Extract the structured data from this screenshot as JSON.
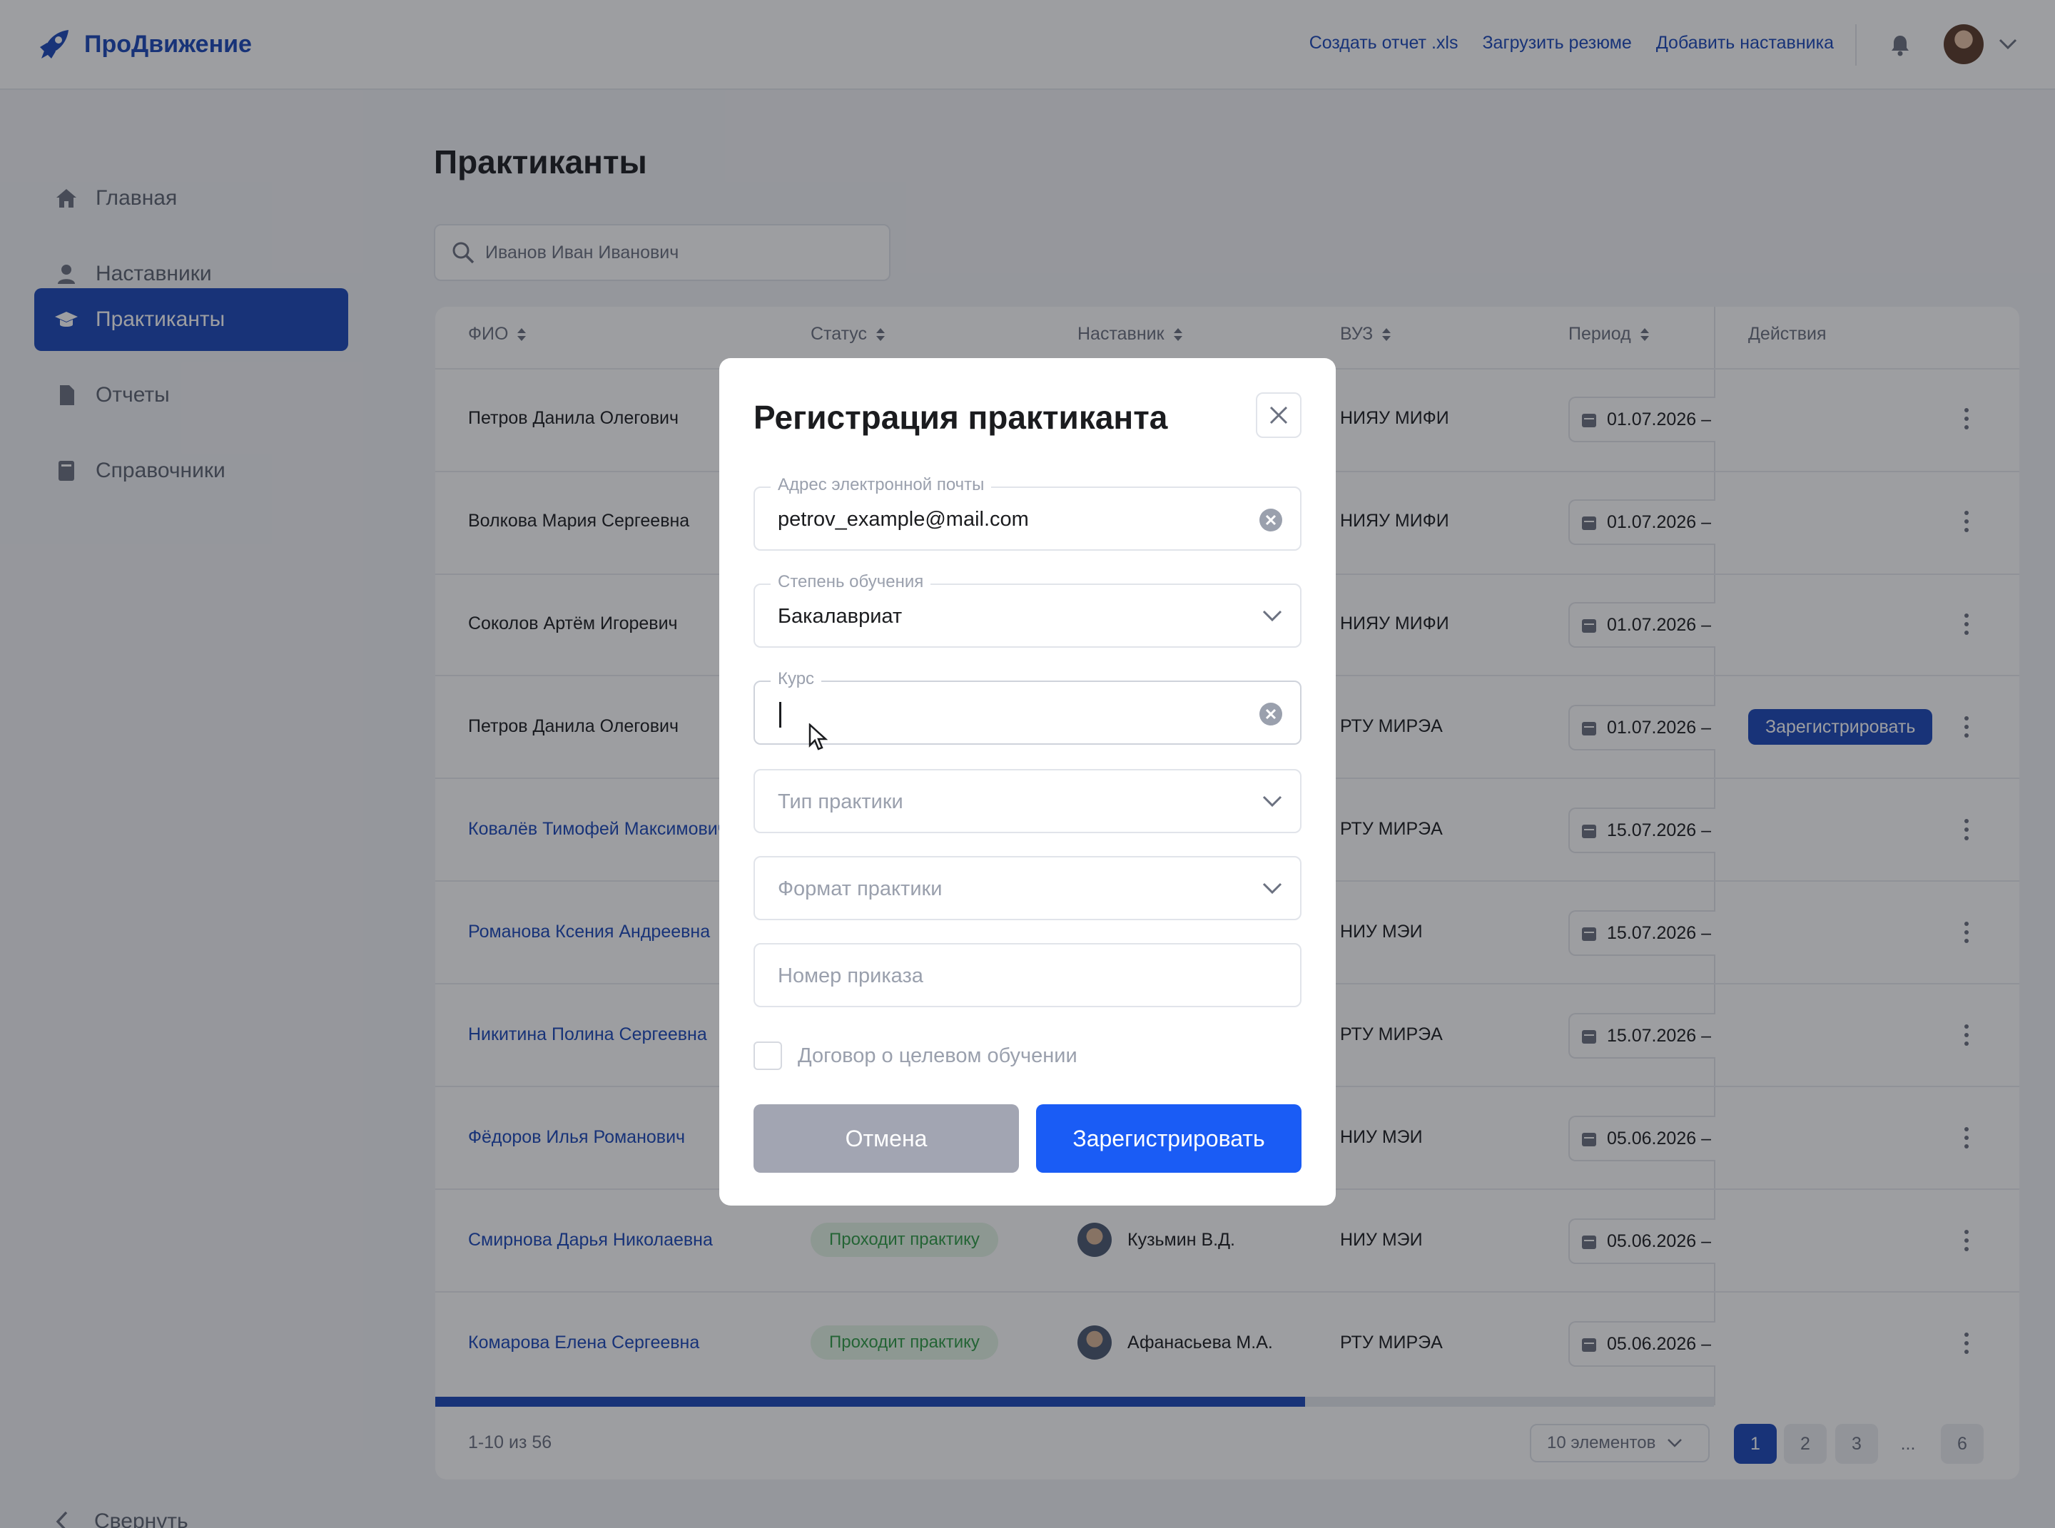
{
  "app": {
    "name": "ПроДвижение"
  },
  "header": {
    "links": [
      "Создать отчет .xls",
      "Загрузить резюме",
      "Добавить наставника"
    ]
  },
  "sidebar": {
    "items": [
      {
        "label": "Главная",
        "icon": "home-icon"
      },
      {
        "label": "Наставники",
        "icon": "user-icon"
      },
      {
        "label": "Практиканты",
        "icon": "graduation-cap-icon",
        "active": true
      },
      {
        "label": "Отчеты",
        "icon": "document-icon"
      },
      {
        "label": "Справочники",
        "icon": "book-icon"
      }
    ],
    "collapse_label": "Свернуть"
  },
  "page": {
    "title": "Практиканты",
    "search_value": "Иванов Иван Иванович"
  },
  "table": {
    "columns": [
      "ФИО",
      "Статус",
      "Наставник",
      "ВУЗ",
      "Период",
      "Действия"
    ],
    "rows": [
      {
        "name": "Петров Данила Олегович",
        "university": "НИЯУ МИФИ",
        "period": "01.07.2026 –"
      },
      {
        "name": "Волкова Мария Сергеевна",
        "university": "НИЯУ МИФИ",
        "period": "01.07.2026 –"
      },
      {
        "name": "Соколов Артём Игоревич",
        "university": "НИЯУ МИФИ",
        "period": "01.07.2026 –"
      },
      {
        "name": "Петров Данила Олегович",
        "university": "РТУ МИРЭА",
        "period": "01.07.2026 –",
        "action": "Зарегистрировать"
      },
      {
        "name": "Ковалёв Тимофей Максимович",
        "university": "РТУ МИРЭА",
        "period": "15.07.2026 –"
      },
      {
        "name": "Романова Ксения Андреевна",
        "university": "НИУ МЭИ",
        "period": "15.07.2026 –"
      },
      {
        "name": "Никитина Полина Сергеевна",
        "university": "РТУ МИРЭА",
        "period": "15.07.2026 –"
      },
      {
        "name": "Фёдоров Илья Романович",
        "university": "НИУ МЭИ",
        "period": "05.06.2026 –"
      },
      {
        "name": "Смирнова Дарья Николаевна",
        "status": "Проходит практику",
        "mentor": "Кузьмин В.Д.",
        "university": "НИУ МЭИ",
        "period": "05.06.2026 –"
      },
      {
        "name": "Комарова Елена Сергеевна",
        "status": "Проходит практику",
        "mentor": "Афанасьева М.А.",
        "university": "РТУ МИРЭА",
        "period": "05.06.2026 –"
      }
    ],
    "range_text": "1-10 из 56",
    "page_size": "10 элементов",
    "pages": [
      "1",
      "2",
      "3",
      "...",
      "6"
    ],
    "scroll_fraction": 0.68
  },
  "modal": {
    "title": "Регистрация практиканта",
    "email": {
      "label": "Адрес электронной почты",
      "value": "petrov_example@mail.com"
    },
    "degree": {
      "label": "Степень обучения",
      "value": "Бакалавриат"
    },
    "course": {
      "label": "Курс",
      "value": ""
    },
    "practice_type": {
      "placeholder": "Тип практики"
    },
    "practice_format": {
      "placeholder": "Формат практики"
    },
    "order_number": {
      "placeholder": "Номер приказа"
    },
    "contract_checkbox": {
      "label": "Договор о целевом обучении",
      "checked": false
    },
    "cancel_label": "Отмена",
    "submit_label": "Зарегистрировать"
  },
  "colors": {
    "brand": "#1a47b8",
    "primary_button": "#1a5cf5",
    "status_green": "#2f9b45"
  }
}
